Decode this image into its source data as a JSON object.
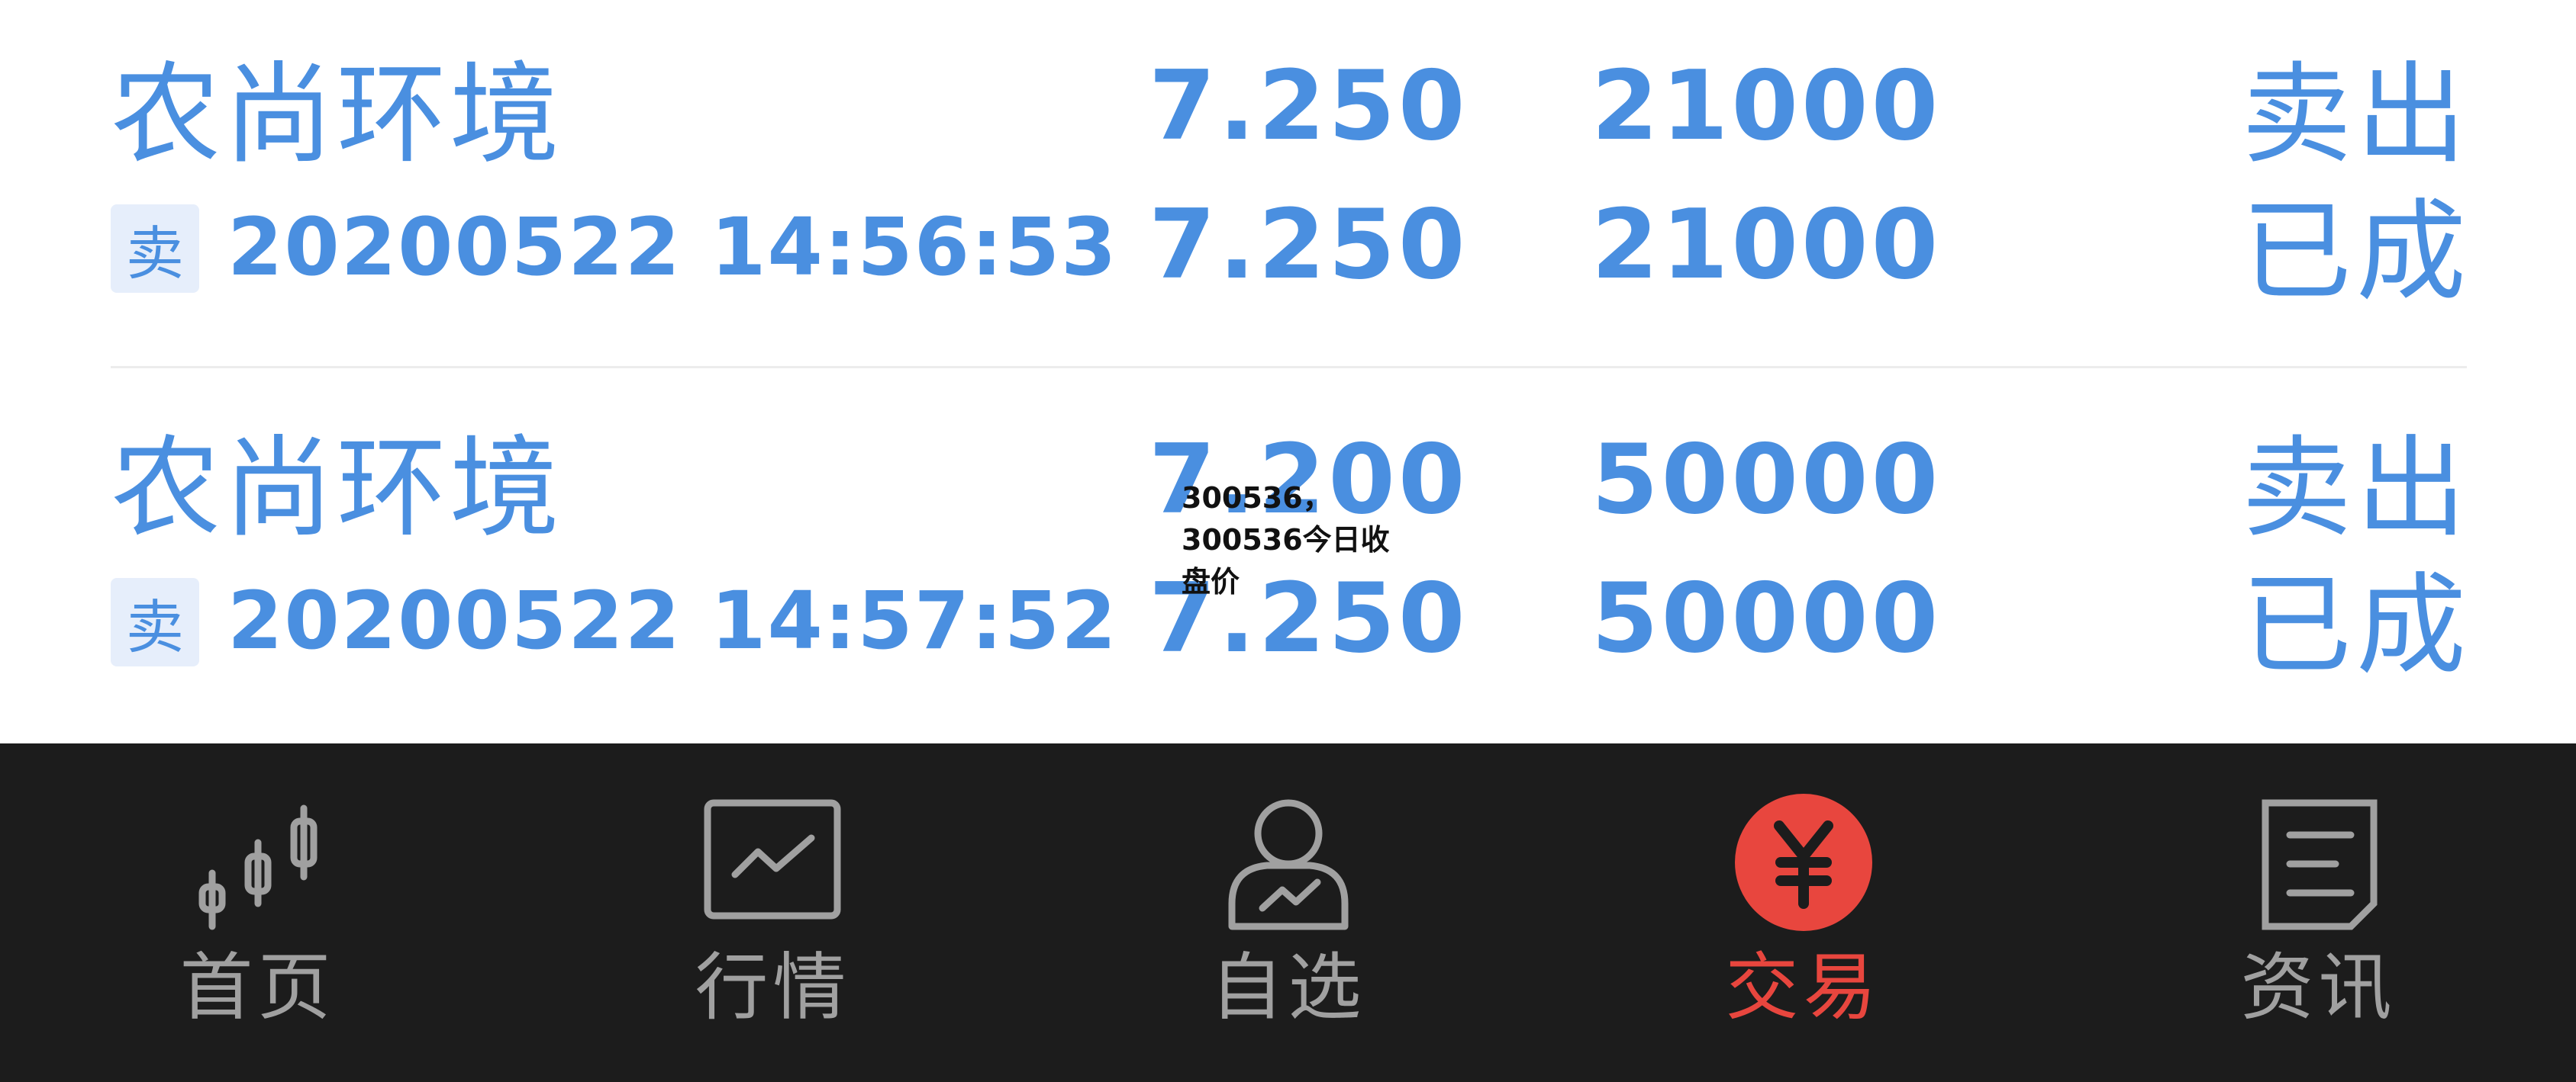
{
  "orders": [
    {
      "stock_name": "农尚环境",
      "side_badge": "卖",
      "datetime": "20200522 14:56:53",
      "order_price": "7.250",
      "filled_price": "7.250",
      "order_qty": "21000",
      "filled_qty": "21000",
      "action": "卖出",
      "status": "已成"
    },
    {
      "stock_name": "农尚环境",
      "side_badge": "卖",
      "datetime": "20200522 14:57:52",
      "order_price": "7.200",
      "filled_price": "7.250",
      "order_qty": "50000",
      "filled_qty": "50000",
      "action": "卖出",
      "status": "已成"
    }
  ],
  "overlay_text": "300536，300536今日收盘价",
  "tabbar": {
    "active_color": "#e8463e",
    "tabs": [
      {
        "label": "首页",
        "icon": "candlestick-icon"
      },
      {
        "label": "行情",
        "icon": "market-chart-icon"
      },
      {
        "label": "自选",
        "icon": "user-trend-icon"
      },
      {
        "label": "交易",
        "icon": "yuan-icon",
        "active": true
      },
      {
        "label": "资讯",
        "icon": "news-document-icon"
      }
    ]
  }
}
